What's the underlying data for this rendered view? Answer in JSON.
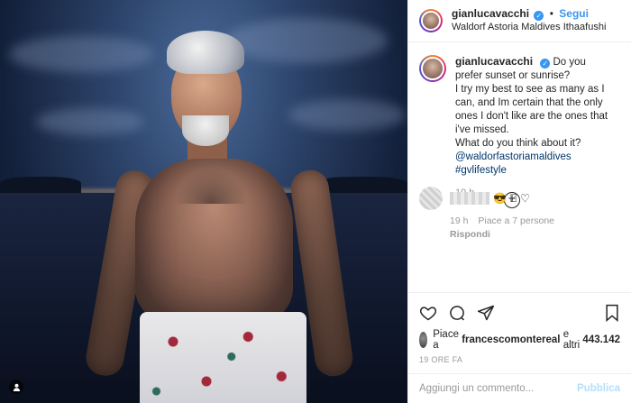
{
  "header": {
    "username": "gianlucavacchi",
    "verified_icon": "verified-badge-icon",
    "separator": "•",
    "follow_label": "Segui",
    "location": "Waldorf Astoria Maldives Ithaafushi"
  },
  "caption": {
    "username": "gianlucavacchi",
    "line1": "Do you prefer sunset or sunrise?",
    "line2": "I try my best to see as many as I can, and Im certain that the only ones I don't like are the ones that i've missed.",
    "line3": "What do you think about it?",
    "mention": "@waldorfastoriamaldives",
    "hashtag": "#gvlifestyle",
    "time": "19 h"
  },
  "load_more_icon": "plus-circle-icon",
  "comment": {
    "emoji": "😎",
    "time": "19 h",
    "likes": "Piace a 7 persone",
    "reply": "Rispondi"
  },
  "actions": {
    "like_icon": "heart-icon",
    "comment_icon": "comment-icon",
    "share_icon": "share-icon",
    "save_icon": "bookmark-icon"
  },
  "likes": {
    "prefix": "Piace a",
    "user": "francescomontereal",
    "middle": "e altri",
    "count": "443.142"
  },
  "date": "19 ORE FA",
  "add_comment": {
    "placeholder": "Aggiungi un commento...",
    "publish_label": "Pubblica"
  }
}
